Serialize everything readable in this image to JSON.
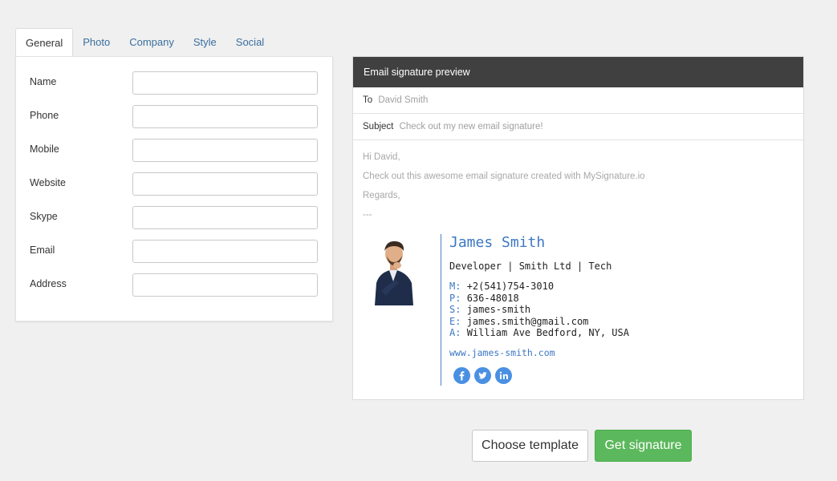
{
  "tabs": [
    {
      "label": "General",
      "active": true
    },
    {
      "label": "Photo",
      "active": false
    },
    {
      "label": "Company",
      "active": false
    },
    {
      "label": "Style",
      "active": false
    },
    {
      "label": "Social",
      "active": false
    }
  ],
  "form": {
    "fields": [
      {
        "label": "Name",
        "value": ""
      },
      {
        "label": "Phone",
        "value": ""
      },
      {
        "label": "Mobile",
        "value": ""
      },
      {
        "label": "Website",
        "value": ""
      },
      {
        "label": "Skype",
        "value": ""
      },
      {
        "label": "Email",
        "value": ""
      },
      {
        "label": "Address",
        "value": ""
      }
    ]
  },
  "preview": {
    "header": "Email signature preview",
    "to_label": "To",
    "to_value": "David Smith",
    "subject_label": "Subject",
    "subject_value": "Check out my new email signature!",
    "body": [
      "Hi David,",
      "Check out this awesome email signature created with MySignature.io",
      "Regards,",
      "---"
    ]
  },
  "signature": {
    "name": "James Smith",
    "title_line": "Developer | Smith Ltd | Tech",
    "contacts": [
      {
        "key": "M:",
        "value": "+2(541)754-3010"
      },
      {
        "key": "P:",
        "value": "636-48018"
      },
      {
        "key": "S:",
        "value": "james-smith"
      },
      {
        "key": "E:",
        "value": "james.smith@gmail.com"
      },
      {
        "key": "A:",
        "value": "William Ave Bedford, NY, USA"
      }
    ],
    "website": "www.james-smith.com",
    "social_icons": [
      "facebook-icon",
      "twitter-icon",
      "linkedin-icon"
    ],
    "accent_color": "#3d78c3",
    "social_color": "#4a90e2"
  },
  "actions": {
    "choose_template": "Choose template",
    "get_signature": "Get signature",
    "primary_color": "#5cb85c"
  }
}
